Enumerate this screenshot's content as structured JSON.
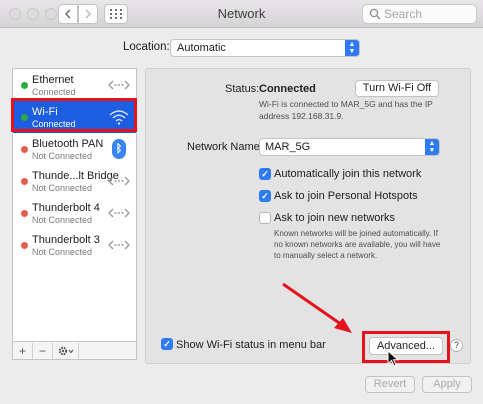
{
  "window": {
    "title": "Network"
  },
  "search": {
    "placeholder": "Search"
  },
  "location": {
    "label": "Location:",
    "value": "Automatic"
  },
  "services": [
    {
      "name": "Ethernet",
      "status": "Connected",
      "status_color": "#27ae3d"
    },
    {
      "name": "Wi-Fi",
      "status": "Connected",
      "status_color": "#27ae3d"
    },
    {
      "name": "Bluetooth PAN",
      "status": "Not Connected",
      "status_color": "#e55b4d"
    },
    {
      "name": "Thunde...lt Bridge",
      "status": "Not Connected",
      "status_color": "#e55b4d"
    },
    {
      "name": "Thunderbolt 4",
      "status": "Not Connected",
      "status_color": "#e55b4d"
    },
    {
      "name": "Thunderbolt 3",
      "status": "Not Connected",
      "status_color": "#e55b4d"
    }
  ],
  "detail": {
    "status_label": "Status:",
    "status_value": "Connected",
    "turn_off_label": "Turn Wi-Fi Off",
    "status_description": "Wi-Fi is connected to MAR_5G and has the IP address 192.168.31.9.",
    "network_name_label": "Network Name:",
    "network_name_value": "MAR_5G",
    "auto_join_label": "Automatically join this network",
    "hotspots_label": "Ask to join Personal Hotspots",
    "new_networks_label": "Ask to join new networks",
    "new_networks_description": "Known networks will be joined automatically. If no known networks are available, you will have to manually select a network.",
    "menu_bar_label": "Show Wi-Fi status in menu bar",
    "advanced_label": "Advanced...",
    "help_label": "?"
  },
  "footer": {
    "revert_label": "Revert",
    "apply_label": "Apply"
  },
  "sidebar_buttons": {
    "add": "+",
    "remove": "−"
  },
  "colors": {
    "selection": "#1d5de0",
    "accent": "#2f7bf6",
    "highlight": "#e3121b"
  }
}
